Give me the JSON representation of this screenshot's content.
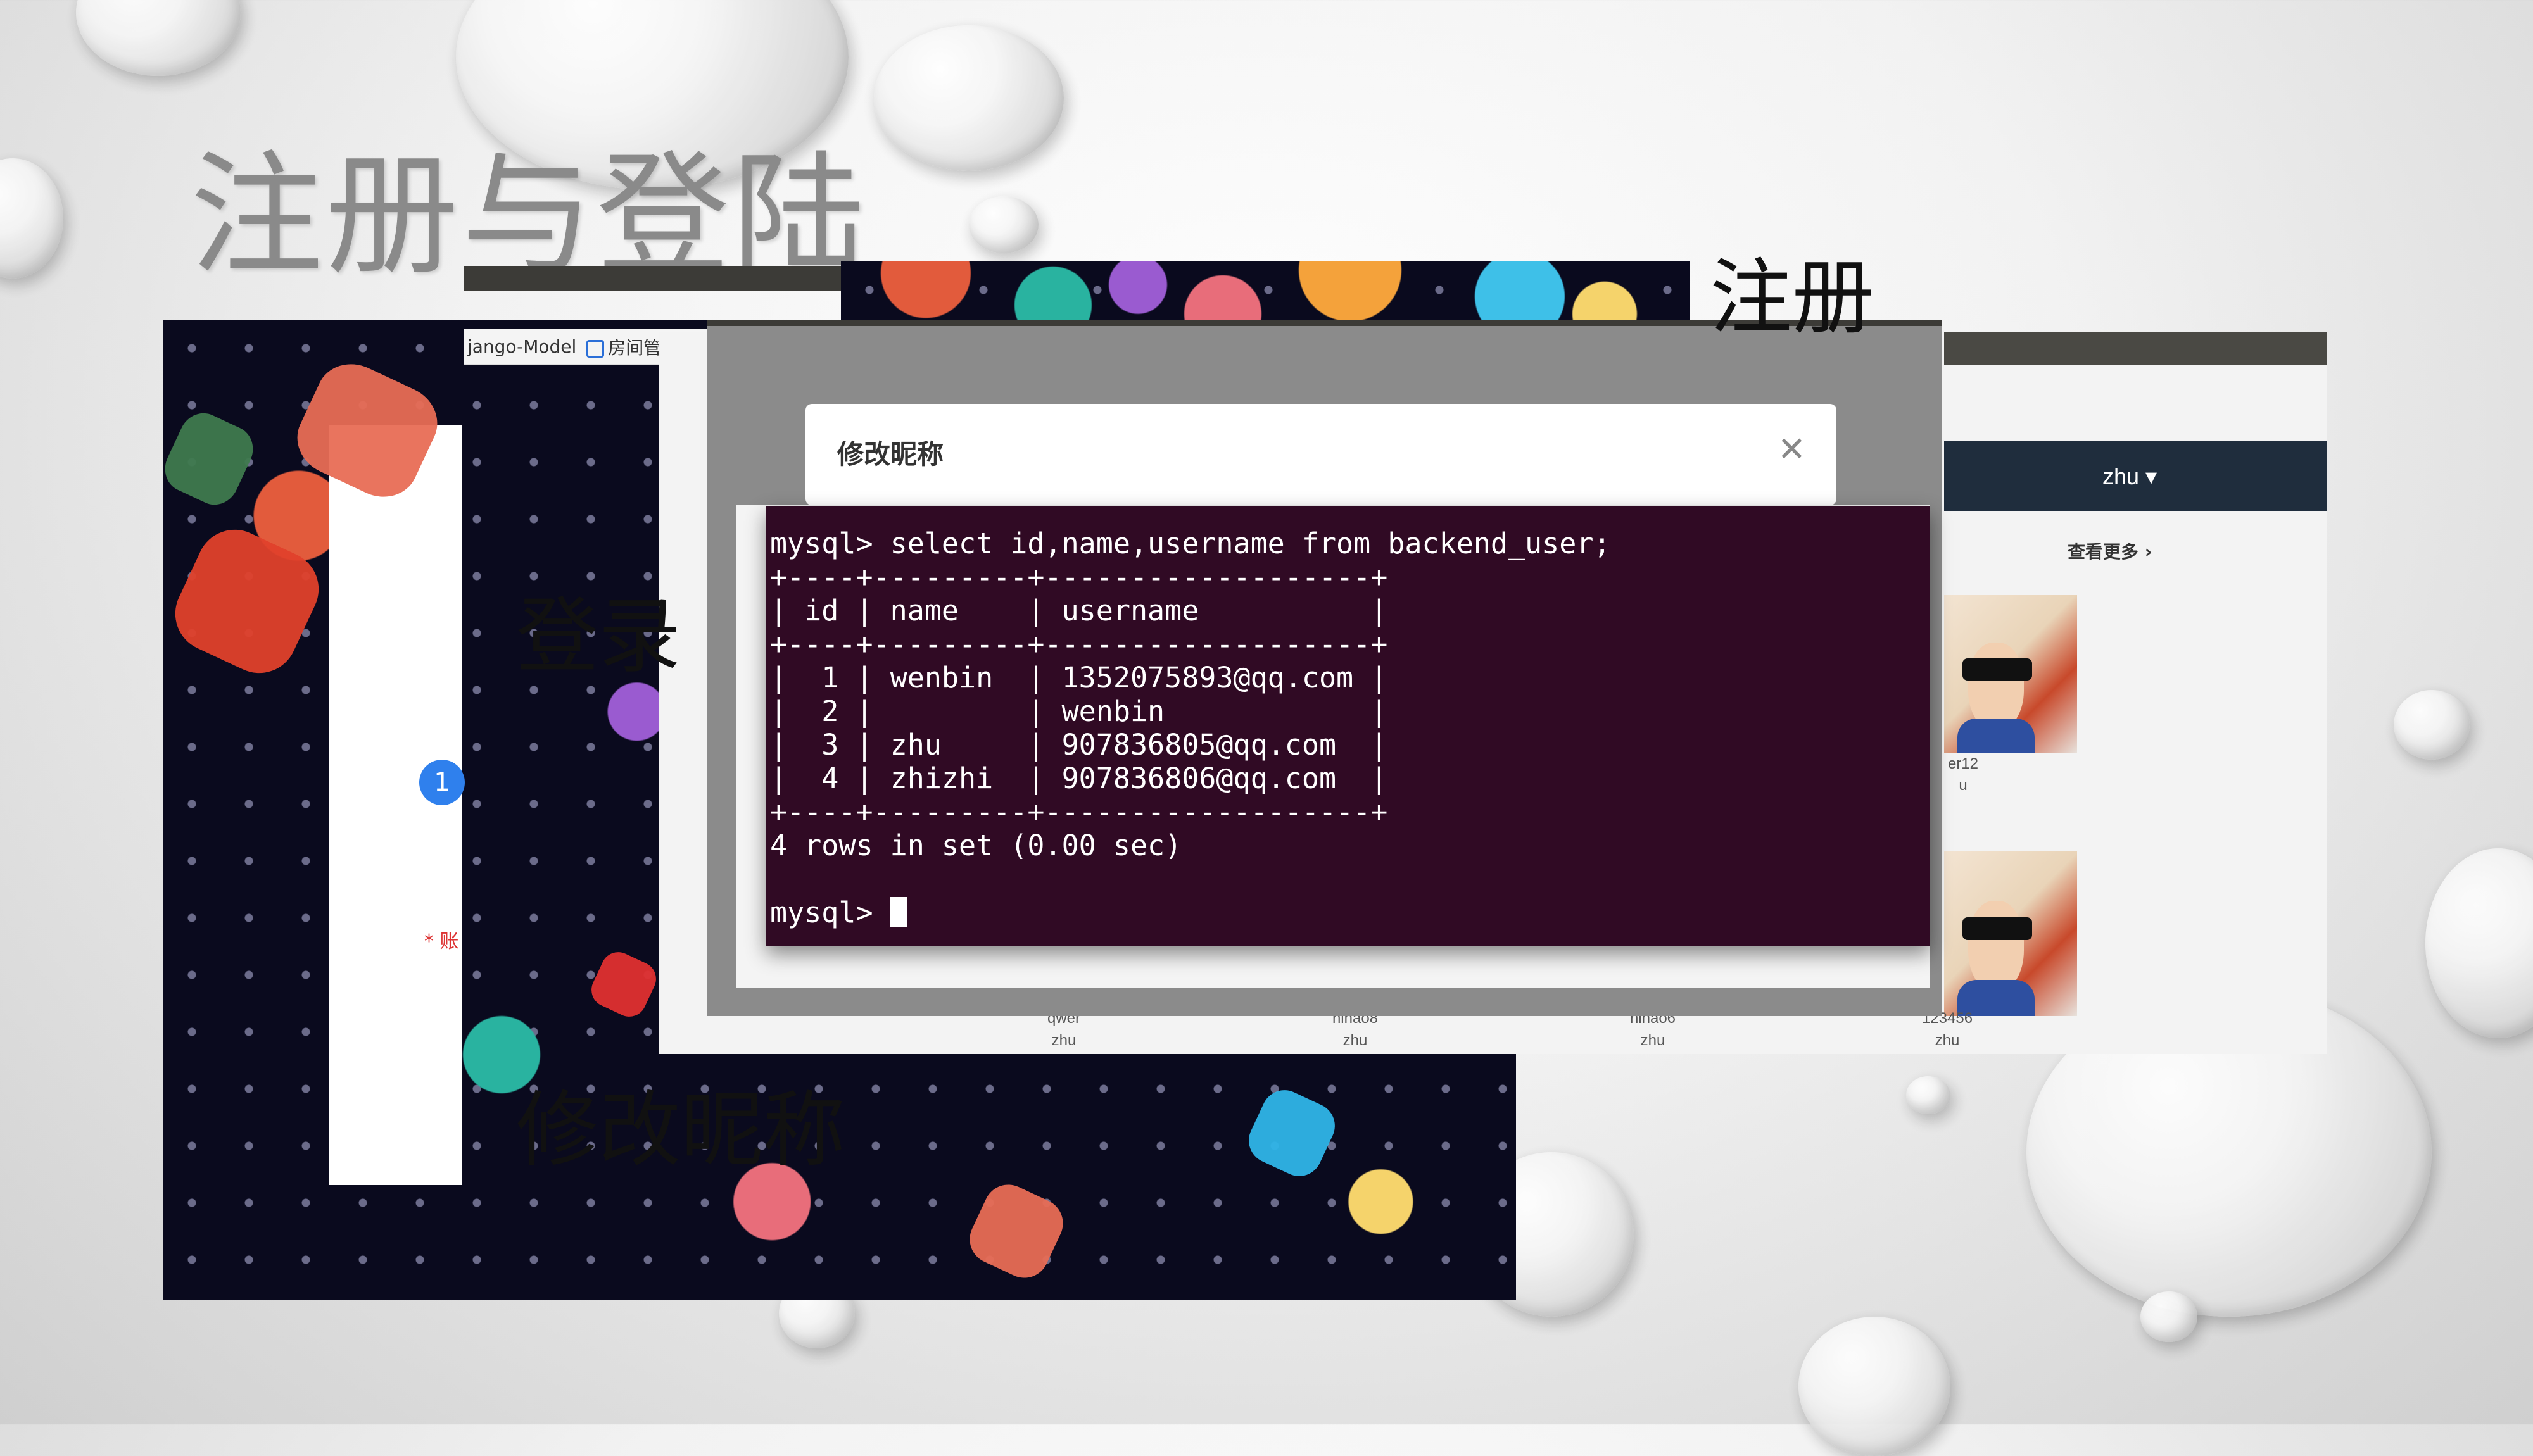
{
  "slide": {
    "title": "注册与登陆",
    "label_register": "注册",
    "label_login": "登录",
    "label_rename": "修改昵称"
  },
  "login_window": {
    "step_badge": "1",
    "field_label": "* 账"
  },
  "browser": {
    "tab1": "jango-Model",
    "tab2": "房间管理"
  },
  "modal": {
    "title": "修改昵称",
    "close_icon": "close-icon"
  },
  "terminal": {
    "command_line": "mysql> select id,name,username from backend_user;",
    "border_top": "+----+---------+-------------------+",
    "header_row": "| id | name    | username          |",
    "border_mid": "+----+---------+-------------------+",
    "rows": [
      "|  1 | wenbin  | 1352075893@qq.com |",
      "|  2 |         | wenbin            |",
      "|  3 | zhu     | 907836805@qq.com  |",
      "|  4 | zhizhi  | 907836806@qq.com  |"
    ],
    "border_bottom": "+----+---------+-------------------+",
    "summary": "4 rows in set (0.00 sec)",
    "prompt": "mysql> "
  },
  "chart_data": {
    "type": "table",
    "columns": [
      "id",
      "name",
      "username"
    ],
    "rows": [
      [
        1,
        "wenbin",
        "1352075893@qq.com"
      ],
      [
        2,
        "",
        "wenbin"
      ],
      [
        3,
        "zhu",
        "907836805@qq.com"
      ],
      [
        4,
        "zhizhi",
        "907836806@qq.com"
      ]
    ]
  },
  "site": {
    "user_menu": "zhu ▾",
    "see_more": "查看更多 ›",
    "cards": [
      {
        "title": "qwer",
        "user": "zhu"
      },
      {
        "title": "nihao8",
        "user": "zhu"
      },
      {
        "title": "nihao6",
        "user": "zhu"
      },
      {
        "title": "123456",
        "user": "zhu"
      }
    ],
    "side_card_title": "er12",
    "side_card_user": "u"
  },
  "colors": {
    "terminal_bg": "#300a24",
    "site_header": "#1f2d3d",
    "badge_blue": "#2f80ed"
  }
}
